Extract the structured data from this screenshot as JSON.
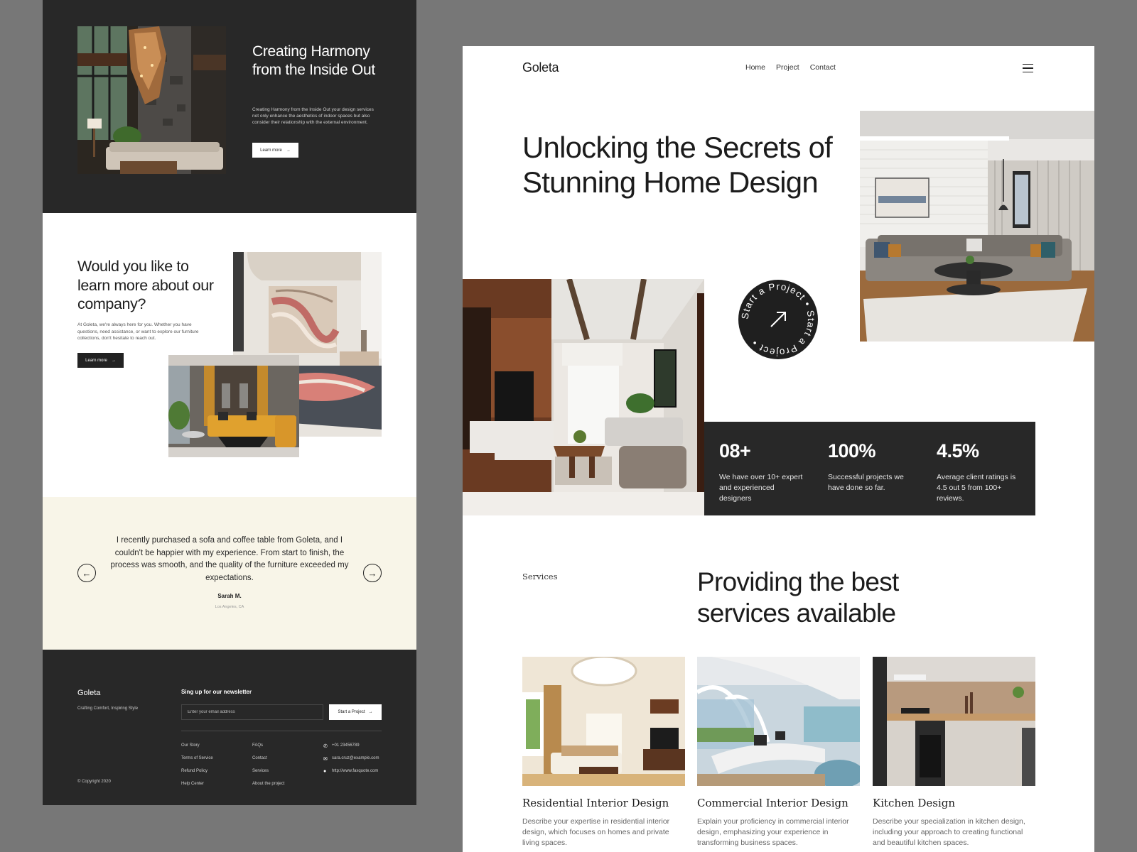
{
  "left": {
    "hero": {
      "title": "Creating Harmony from the Inside Out",
      "description": "Creating Harmony from the Inside Out your design services not only enhance the aesthetics of indoor spaces but also consider their relationship with the external environment.",
      "button_label": "Learn more",
      "image": "interior-living-room-stone-wall-chandelier"
    },
    "about": {
      "title": "Would you like to learn more about our company?",
      "description": "At Goleta, we're always here for you. Whether you have questions, need assistance, or want to explore our furniture collections, don't hesitate to reach out.",
      "button_label": "Learn more",
      "images": [
        "interior-abstract-art-wall",
        "interior-yellow-sofa-lounge"
      ]
    },
    "testimonial": {
      "quote": "I recently purchased a sofa and coffee table from Goleta, and I couldn't be happier with my experience. From start to finish, the process was smooth, and the quality of the furniture exceeded my expectations.",
      "author": "Sarah M.",
      "location": "Los Angeles, CA",
      "prev_icon": "arrow-left-icon",
      "next_icon": "arrow-right-icon"
    },
    "footer": {
      "brand": "Goleta",
      "tagline": "Crafting Comfort, Inspiring Style",
      "copyright": "© Copyright 2020",
      "newsletter_title": "Sing up for our newsletter",
      "email_placeholder": "Enter your email address",
      "cta_label": "Start a Project",
      "links_col1": [
        "Our Story",
        "Terms of Service",
        "Refund Policy",
        "Help Center"
      ],
      "links_col2": [
        "FAQs",
        "Contact",
        "Services",
        "About the project"
      ],
      "contacts": [
        {
          "icon": "phone-icon",
          "text": "+01 23456789"
        },
        {
          "icon": "mail-icon",
          "text": "sara.cruz@example.com"
        },
        {
          "icon": "globe-icon",
          "text": "http://www.faxquote.com"
        }
      ]
    }
  },
  "right": {
    "logo": "Goleta",
    "nav": [
      "Home",
      "Project",
      "Contact"
    ],
    "menu_icon": "hamburger-icon",
    "hero": {
      "title": "Unlocking the Secrets of Stunning Home Design",
      "badge_text": "Start a Project • Start a Project • ",
      "images": [
        "interior-grey-sectional-living-room",
        "interior-wood-tv-wall-living-room"
      ]
    },
    "stats": [
      {
        "value": "08+",
        "description": "We have over 10+ expert and experienced designers"
      },
      {
        "value": "100%",
        "description": "Successful projects we have done so far."
      },
      {
        "value": "4.5%",
        "description": "Average client ratings is 4.5 out 5 from 100+ reviews."
      }
    ],
    "services": {
      "label": "Services",
      "title": "Providing the best services available",
      "cards": [
        {
          "title": "Residential Interior Design",
          "description": "Describe your expertise in residential interior design, which focuses on homes and private living spaces.",
          "image": "residential-interior"
        },
        {
          "title": "Commercial Interior Design",
          "description": "Explain your proficiency in commercial interior design, emphasizing your experience in transforming business spaces.",
          "image": "commercial-office-interior"
        },
        {
          "title": "Kitchen Design",
          "description": "Describe your specialization in kitchen design, including your approach to creating functional and beautiful kitchen spaces.",
          "image": "kitchen-interior"
        }
      ]
    }
  }
}
